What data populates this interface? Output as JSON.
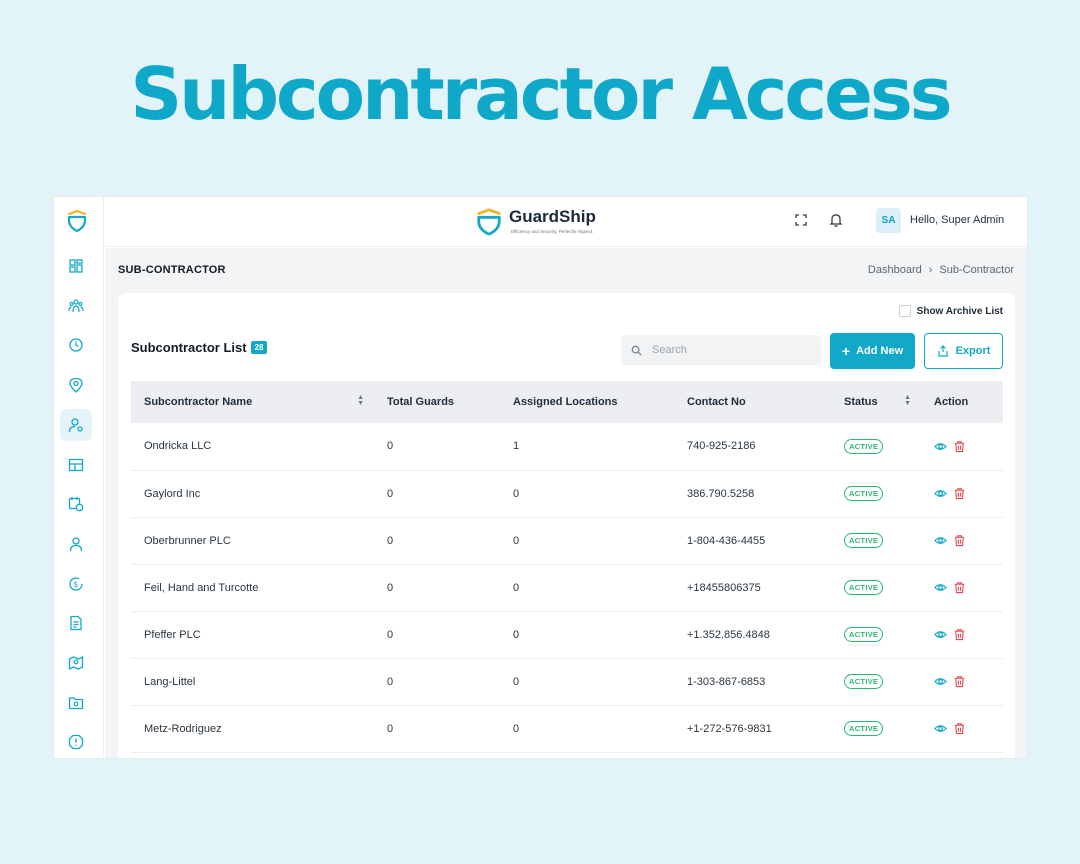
{
  "hero": {
    "title": "Subcontractor Access"
  },
  "brand": {
    "name": "GuardShip",
    "tagline": "Efficiency and Security, Perfectly Aligned."
  },
  "user": {
    "initials": "SA",
    "greeting": "Hello, Super Admin"
  },
  "sidebar": {
    "items": [
      {
        "icon": "dashboard-icon"
      },
      {
        "icon": "users-group-icon"
      },
      {
        "icon": "clock-icon"
      },
      {
        "icon": "location-pin-icon"
      },
      {
        "icon": "user-settings-icon",
        "active": true
      },
      {
        "icon": "layout-icon"
      },
      {
        "icon": "calendar-clock-icon"
      },
      {
        "icon": "user-icon"
      },
      {
        "icon": "dollar-refresh-icon"
      },
      {
        "icon": "document-icon"
      },
      {
        "icon": "map-user-icon"
      },
      {
        "icon": "folder-settings-icon"
      },
      {
        "icon": "alert-icon"
      }
    ]
  },
  "page": {
    "heading": "SUB-CONTRACTOR",
    "breadcrumb": [
      "Dashboard",
      "Sub-Contractor"
    ]
  },
  "list": {
    "title": "Subcontractor List",
    "count": "28",
    "archive_label": "Show Archive List",
    "search_placeholder": "Search",
    "add_label": "Add New",
    "export_label": "Export"
  },
  "table": {
    "columns": [
      "Subcontractor Name",
      "Total Guards",
      "Assigned Locations",
      "Contact No",
      "Status",
      "Action"
    ],
    "rows": [
      {
        "name": "Ondricka LLC",
        "guards": "0",
        "locations": "1",
        "contact": "740-925-2186",
        "status": "ACTIVE"
      },
      {
        "name": "Gaylord Inc",
        "guards": "0",
        "locations": "0",
        "contact": "386.790.5258",
        "status": "ACTIVE"
      },
      {
        "name": "Oberbrunner PLC",
        "guards": "0",
        "locations": "0",
        "contact": "1-804-436-4455",
        "status": "ACTIVE"
      },
      {
        "name": "Feil, Hand and Turcotte",
        "guards": "0",
        "locations": "0",
        "contact": "+18455806375",
        "status": "ACTIVE"
      },
      {
        "name": "Pfeffer PLC",
        "guards": "0",
        "locations": "0",
        "contact": "+1.352.856.4848",
        "status": "ACTIVE"
      },
      {
        "name": "Lang-Littel",
        "guards": "0",
        "locations": "0",
        "contact": "1-303-867-6853",
        "status": "ACTIVE"
      },
      {
        "name": "Metz-Rodriguez",
        "guards": "0",
        "locations": "0",
        "contact": "+1-272-576-9831",
        "status": "ACTIVE"
      }
    ]
  },
  "colors": {
    "accent": "#12a9c9",
    "active": "#2bb673",
    "delete": "#e5484d"
  }
}
